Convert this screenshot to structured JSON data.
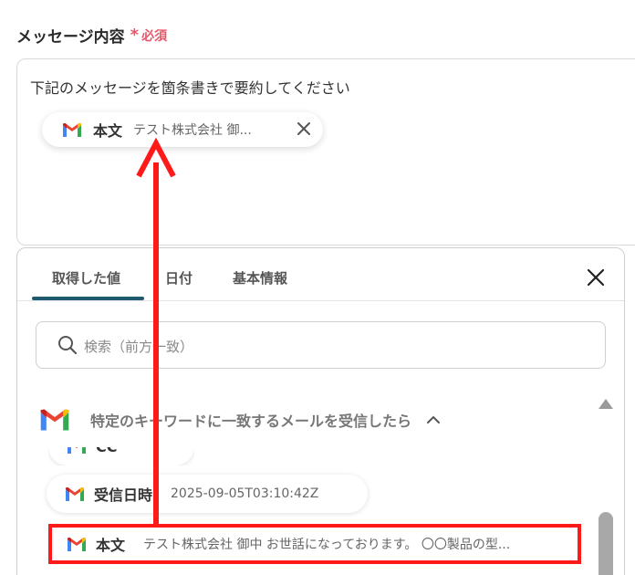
{
  "field": {
    "label": "メッセージ内容",
    "required_mark": "*",
    "required_text": "必須"
  },
  "message": {
    "text": "下記のメッセージを箇条書きで要約してください",
    "chip": {
      "title": "本文",
      "value": "テスト株式会社 御..."
    }
  },
  "panel": {
    "tabs": [
      {
        "label": "取得した値",
        "active": true
      },
      {
        "label": "日付",
        "active": false
      },
      {
        "label": "基本情報",
        "active": false
      }
    ],
    "search_placeholder": "検索（前方一致）",
    "group": {
      "title": "特定のキーワードに一致するメールを受信したら",
      "expanded": true
    },
    "partial_item_text": "CC",
    "items": [
      {
        "title": "受信日時",
        "value": "2025-09-05T03:10:42Z"
      },
      {
        "title": "本文",
        "value": "テスト株式会社 御中 お世話になっております。 〇〇製品の型...",
        "highlighted": true
      }
    ]
  },
  "colors": {
    "accent": "#1e5b73",
    "required": "#e8566a",
    "annotation": "#ff1a1a"
  }
}
